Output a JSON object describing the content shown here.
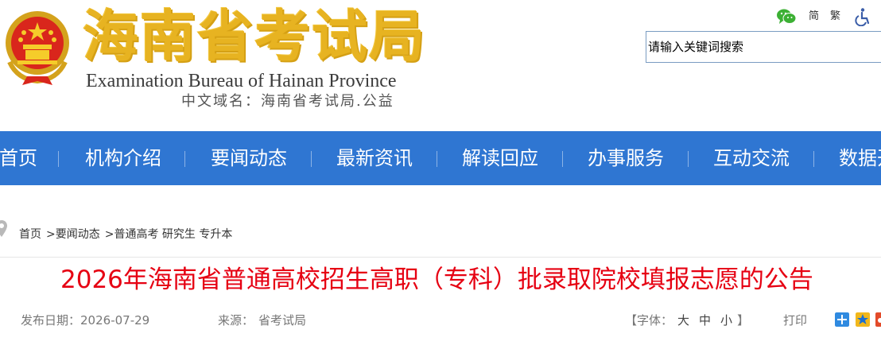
{
  "header": {
    "title_cn": "海南省考试局",
    "title_en": "Examination Bureau of Hainan Province",
    "domain_text": "中文域名：海南省考试局.公益",
    "lang_simplified": "简",
    "lang_traditional": "繁",
    "search_placeholder": "请输入关键词搜索"
  },
  "nav": {
    "items": [
      {
        "label": "首页"
      },
      {
        "label": "机构介绍"
      },
      {
        "label": "要闻动态"
      },
      {
        "label": "最新资讯"
      },
      {
        "label": "解读回应"
      },
      {
        "label": "办事服务"
      },
      {
        "label": "互动交流"
      },
      {
        "label": "数据开"
      }
    ]
  },
  "breadcrumb": {
    "items": [
      "首页",
      "要闻动态",
      "普通高考 研究生 专升本"
    ],
    "separator": ">"
  },
  "article": {
    "title": "2026年海南省普通高校招生高职（专科）批录取院校填报志愿的公告",
    "date_label": "发布日期：",
    "date": "2026-07-29",
    "source_label": "来源：",
    "source": "省考试局",
    "font_open": "【字体：",
    "font_large": "大",
    "font_medium": "中",
    "font_small": "小",
    "font_close": "】",
    "print": "打印"
  },
  "colors": {
    "nav_bg": "#2f76d2",
    "title_gold": "#e7b321",
    "article_title_red": "#e60012"
  },
  "icons": [
    "national-emblem-icon",
    "wechat-icon",
    "accessibility-icon",
    "location-pin-icon",
    "share-plus-icon",
    "qzone-icon",
    "weibo-icon"
  ]
}
